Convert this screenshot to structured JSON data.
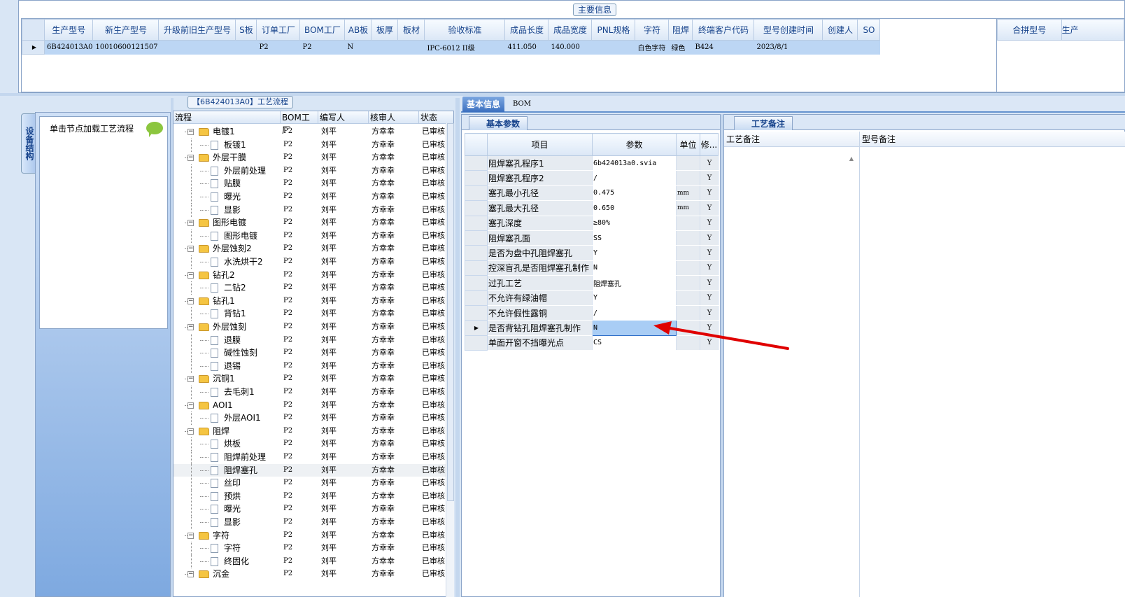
{
  "main": {
    "title": "主要信息",
    "columns": [
      "生产型号",
      "新生产型号",
      "升级前旧生产型号",
      "S板",
      "订单工厂",
      "BOM工厂",
      "AB板",
      "板厚",
      "板材",
      "验收标准",
      "成品长度",
      "成品宽度",
      "PNL规格",
      "字符",
      "阻焊",
      "终端客户代码",
      "型号创建时间",
      "创建人",
      "SO"
    ],
    "row": [
      "6B424013A0",
      "10010600121507",
      "",
      "",
      "P2",
      "P2",
      "N",
      "",
      "",
      "IPC-6012 II级",
      "411.050",
      "140.000",
      "",
      "白色字符",
      "绿色",
      "B424",
      "2023/8/1",
      "",
      ""
    ]
  },
  "merge": {
    "columns": [
      "合拼型号",
      "生产"
    ]
  },
  "side_tab": "设备结构",
  "left": {
    "hint": "单击节点加载工艺流程"
  },
  "flow": {
    "title": "【6B424013A0】工艺流程",
    "headers": [
      "流程",
      "BOM工厂",
      "编写人",
      "核审人",
      "状态"
    ],
    "rows": [
      {
        "label": "电镀1",
        "bom": "P2",
        "author": "刘平",
        "reviewer": "方幸幸",
        "status": "已审核"
      },
      {
        "label": "板镀1",
        "bom": "P2",
        "author": "刘平",
        "reviewer": "方幸幸",
        "status": "已审核"
      },
      {
        "label": "外层干膜",
        "bom": "P2",
        "author": "刘平",
        "reviewer": "方幸幸",
        "status": "已审核"
      },
      {
        "label": "外层前处理",
        "bom": "P2",
        "author": "刘平",
        "reviewer": "方幸幸",
        "status": "已审核"
      },
      {
        "label": "贴膜",
        "bom": "P2",
        "author": "刘平",
        "reviewer": "方幸幸",
        "status": "已审核"
      },
      {
        "label": "曝光",
        "bom": "P2",
        "author": "刘平",
        "reviewer": "方幸幸",
        "status": "已审核"
      },
      {
        "label": "显影",
        "bom": "P2",
        "author": "刘平",
        "reviewer": "方幸幸",
        "status": "已审核"
      },
      {
        "label": "图形电镀",
        "bom": "P2",
        "author": "刘平",
        "reviewer": "方幸幸",
        "status": "已审核"
      },
      {
        "label": "图形电镀",
        "bom": "P2",
        "author": "刘平",
        "reviewer": "方幸幸",
        "status": "已审核"
      },
      {
        "label": "外层蚀刻2",
        "bom": "P2",
        "author": "刘平",
        "reviewer": "方幸幸",
        "status": "已审核"
      },
      {
        "label": "水洗烘干2",
        "bom": "P2",
        "author": "刘平",
        "reviewer": "方幸幸",
        "status": "已审核"
      },
      {
        "label": "钻孔2",
        "bom": "P2",
        "author": "刘平",
        "reviewer": "方幸幸",
        "status": "已审核"
      },
      {
        "label": "二钻2",
        "bom": "P2",
        "author": "刘平",
        "reviewer": "方幸幸",
        "status": "已审核"
      },
      {
        "label": "钻孔1",
        "bom": "P2",
        "author": "刘平",
        "reviewer": "方幸幸",
        "status": "已审核"
      },
      {
        "label": "背钻1",
        "bom": "P2",
        "author": "刘平",
        "reviewer": "方幸幸",
        "status": "已审核"
      },
      {
        "label": "外层蚀刻",
        "bom": "P2",
        "author": "刘平",
        "reviewer": "方幸幸",
        "status": "已审核"
      },
      {
        "label": "退膜",
        "bom": "P2",
        "author": "刘平",
        "reviewer": "方幸幸",
        "status": "已审核"
      },
      {
        "label": "碱性蚀刻",
        "bom": "P2",
        "author": "刘平",
        "reviewer": "方幸幸",
        "status": "已审核"
      },
      {
        "label": "退锡",
        "bom": "P2",
        "author": "刘平",
        "reviewer": "方幸幸",
        "status": "已审核"
      },
      {
        "label": "沉铜1",
        "bom": "P2",
        "author": "刘平",
        "reviewer": "方幸幸",
        "status": "已审核"
      },
      {
        "label": "去毛刺1",
        "bom": "P2",
        "author": "刘平",
        "reviewer": "方幸幸",
        "status": "已审核"
      },
      {
        "label": "AOI1",
        "bom": "P2",
        "author": "刘平",
        "reviewer": "方幸幸",
        "status": "已审核"
      },
      {
        "label": "外层AOI1",
        "bom": "P2",
        "author": "刘平",
        "reviewer": "方幸幸",
        "status": "已审核"
      },
      {
        "label": "阻焊",
        "bom": "P2",
        "author": "刘平",
        "reviewer": "方幸幸",
        "status": "已审核"
      },
      {
        "label": "烘板",
        "bom": "P2",
        "author": "刘平",
        "reviewer": "方幸幸",
        "status": "已审核"
      },
      {
        "label": "阻焊前处理",
        "bom": "P2",
        "author": "刘平",
        "reviewer": "方幸幸",
        "status": "已审核"
      },
      {
        "label": "阻焊塞孔",
        "bom": "P2",
        "author": "刘平",
        "reviewer": "方幸幸",
        "status": "已审核"
      },
      {
        "label": "丝印",
        "bom": "P2",
        "author": "刘平",
        "reviewer": "方幸幸",
        "status": "已审核"
      },
      {
        "label": "预烘",
        "bom": "P2",
        "author": "刘平",
        "reviewer": "方幸幸",
        "status": "已审核"
      },
      {
        "label": "曝光",
        "bom": "P2",
        "author": "刘平",
        "reviewer": "方幸幸",
        "status": "已审核"
      },
      {
        "label": "显影",
        "bom": "P2",
        "author": "刘平",
        "reviewer": "方幸幸",
        "status": "已审核"
      },
      {
        "label": "字符",
        "bom": "P2",
        "author": "刘平",
        "reviewer": "方幸幸",
        "status": "已审核"
      },
      {
        "label": "字符",
        "bom": "P2",
        "author": "刘平",
        "reviewer": "方幸幸",
        "status": "已审核"
      },
      {
        "label": "终固化",
        "bom": "P2",
        "author": "刘平",
        "reviewer": "方幸幸",
        "status": "已审核"
      },
      {
        "label": "沉金",
        "bom": "P2",
        "author": "刘平",
        "reviewer": "方幸幸",
        "status": "已审核"
      }
    ]
  },
  "tabs": [
    "基本信息",
    "BOM"
  ],
  "basic": {
    "subtab": "基本参数",
    "headers": [
      "项目",
      "参数",
      "单位",
      "修..."
    ],
    "rows": [
      {
        "item": "阻焊塞孔程序1",
        "value": "6b424013a0.svia",
        "unit": "",
        "rev": "Y"
      },
      {
        "item": "阻焊塞孔程序2",
        "value": "/",
        "unit": "",
        "rev": "Y"
      },
      {
        "item": "塞孔最小孔径",
        "value": "0.475",
        "unit": "mm",
        "rev": "Y"
      },
      {
        "item": "塞孔最大孔径",
        "value": "0.650",
        "unit": "mm",
        "rev": "Y"
      },
      {
        "item": "塞孔深度",
        "value": "≥80%",
        "unit": "",
        "rev": "Y"
      },
      {
        "item": "阻焊塞孔面",
        "value": "SS",
        "unit": "",
        "rev": "Y"
      },
      {
        "item": "是否为盘中孔阻焊塞孔",
        "value": "Y",
        "unit": "",
        "rev": "Y"
      },
      {
        "item": "控深盲孔是否阻焊塞孔制作",
        "value": "N",
        "unit": "",
        "rev": "Y"
      },
      {
        "item": "过孔工艺",
        "value": "阻焊塞孔",
        "unit": "",
        "rev": "Y"
      },
      {
        "item": "不允许有绿油帽",
        "value": "Y",
        "unit": "",
        "rev": "Y"
      },
      {
        "item": "不允许假性露铜",
        "value": "/",
        "unit": "",
        "rev": "Y"
      },
      {
        "item": "是否背钻孔阻焊塞孔制作",
        "value": "N",
        "unit": "",
        "rev": "Y"
      },
      {
        "item": "单面开窗不挡曝光点",
        "value": "CS",
        "unit": "",
        "rev": "Y"
      }
    ]
  },
  "remark": {
    "tab": "工艺备注",
    "col1": "工艺备注",
    "col2": "型号备注"
  },
  "colors": {
    "accent": "#3c70c0",
    "annotation_arrow": "#e00000",
    "selection": "#bcd6f4"
  }
}
